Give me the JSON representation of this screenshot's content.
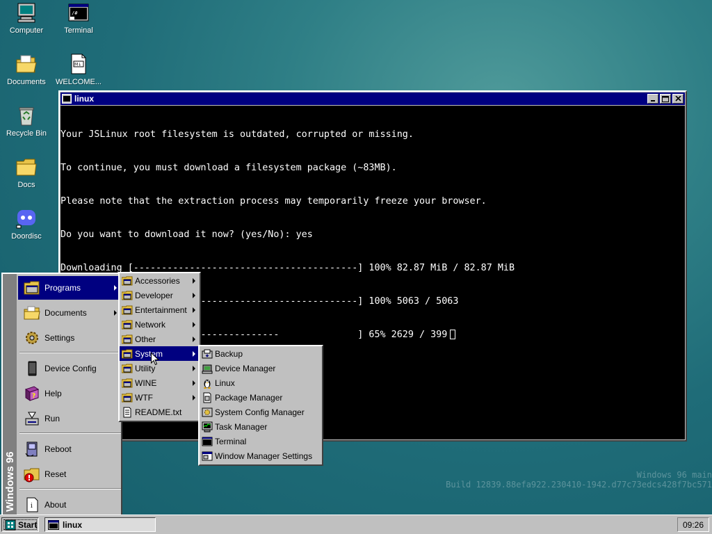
{
  "desktop": {
    "icons": [
      {
        "label": "Computer",
        "icon": "computer-icon"
      },
      {
        "label": "Terminal",
        "icon": "terminal-icon"
      },
      {
        "label": "Documents",
        "icon": "documents-folder-icon"
      },
      {
        "label": "WELCOME...",
        "icon": "markdown-file-icon"
      },
      {
        "label": "Recycle Bin",
        "icon": "recycle-bin-icon"
      },
      {
        "label": "Docs",
        "icon": "folder-icon"
      },
      {
        "label": "Doordisc",
        "icon": "doordisc-icon"
      }
    ],
    "watermark": {
      "line1": "Windows 96 main",
      "line2": "Build 12839.88efa922.230410-1942.d77c73edcs428f7bc571"
    }
  },
  "window": {
    "title": "linux",
    "terminal_lines": [
      "Your JSLinux root filesystem is outdated, corrupted or missing.",
      "To continue, you must download a filesystem package (~83MB).",
      "Please note that the extraction process may temporarily freeze your browser.",
      "Do you want to download it now? (yes/No): yes",
      "Downloading [----------------------------------------] 100% 82.87 MiB / 82.87 MiB",
      "Extracting  [----------------------------------------] 100% 5063 / 5063",
      "Writing     [--------------------------              ] 65% 2629 / 399"
    ]
  },
  "start_menu": {
    "sidebar_text": "Windows 96",
    "items": [
      {
        "label": "Programs",
        "submenu": true
      },
      {
        "label": "Documents",
        "submenu": true
      },
      {
        "label": "Settings",
        "submenu": false
      },
      {
        "label": "Device Config",
        "submenu": false
      },
      {
        "label": "Help",
        "submenu": false
      },
      {
        "label": "Run",
        "submenu": false
      },
      {
        "label": "Reboot",
        "submenu": false
      },
      {
        "label": "Reset",
        "submenu": false
      },
      {
        "label": "About",
        "submenu": false
      }
    ],
    "programs_submenu": [
      {
        "label": "Accessories",
        "submenu": true
      },
      {
        "label": "Developer",
        "submenu": true
      },
      {
        "label": "Entertainment",
        "submenu": true
      },
      {
        "label": "Network",
        "submenu": true
      },
      {
        "label": "Other",
        "submenu": true
      },
      {
        "label": "System",
        "submenu": true
      },
      {
        "label": "Utility",
        "submenu": true
      },
      {
        "label": "WINE",
        "submenu": true
      },
      {
        "label": "WTF",
        "submenu": true
      },
      {
        "label": "README.txt",
        "submenu": false
      }
    ],
    "system_submenu": [
      {
        "label": "Backup"
      },
      {
        "label": "Device Manager"
      },
      {
        "label": "Linux"
      },
      {
        "label": "Package Manager"
      },
      {
        "label": "System Config Manager"
      },
      {
        "label": "Task Manager"
      },
      {
        "label": "Terminal"
      },
      {
        "label": "Window Manager Settings"
      }
    ]
  },
  "taskbar": {
    "start_label": "Start",
    "task_label": "linux",
    "clock": "09:26"
  },
  "colors": {
    "titlebar": "#000080",
    "highlight": "#000080",
    "face": "#c0c0c0"
  }
}
